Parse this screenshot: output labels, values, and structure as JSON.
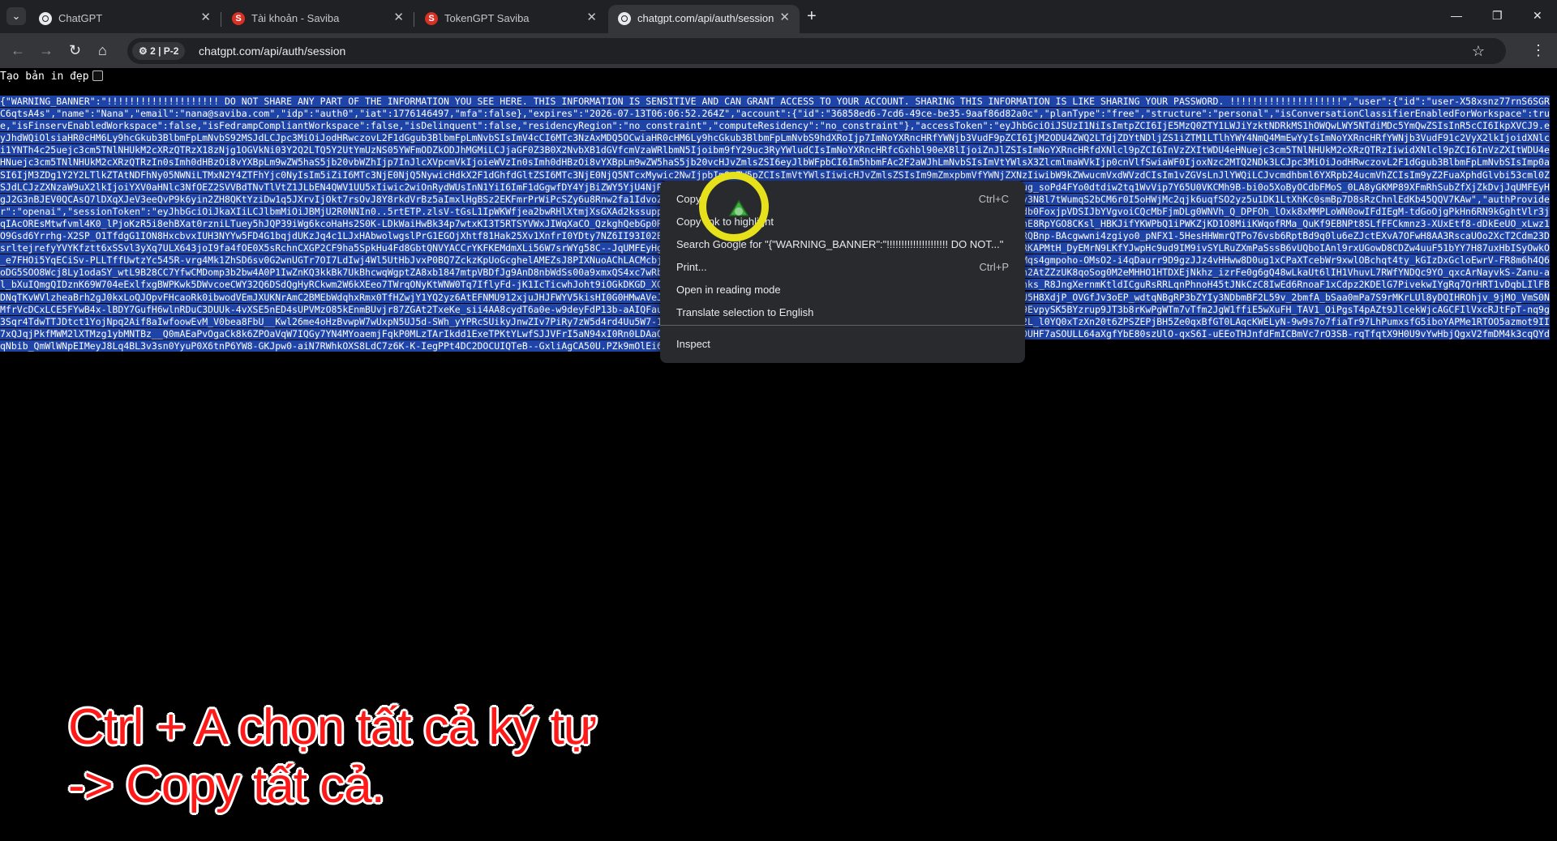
{
  "browser": {
    "tabs": [
      {
        "title": "ChatGPT",
        "favicon": "chatgpt-icon",
        "active": false
      },
      {
        "title": "Tài khoản - Saviba",
        "favicon": "saviba-icon",
        "active": false
      },
      {
        "title": "TokenGPT Saviba",
        "favicon": "saviba-icon",
        "active": false
      },
      {
        "title": "chatgpt.com/api/auth/session",
        "favicon": "chatgpt-icon",
        "active": true
      }
    ],
    "profile_chip": "2 | P-2",
    "url": "chatgpt.com/api/auth/session"
  },
  "page": {
    "pretty_print_label": "Tạo bản in đẹp",
    "json_text": "{\"WARNING_BANNER\":\"!!!!!!!!!!!!!!!!!!!! DO NOT SHARE ANY PART OF THE INFORMATION YOU SEE HERE. THIS INFORMATION IS SENSITIVE AND CAN GRANT ACCESS TO YOUR ACCOUNT. SHARING THIS INFORMATION IS LIKE SHARING YOUR PASSWORD. !!!!!!!!!!!!!!!!!!!!\",\"user\":{\"id\":\"user-X58xsnz77rnS6SGRC6qtsA4s\",\"name\":\"Nana\",\"email\":\"nana@saviba.com\",\"idp\":\"auth0\",\"iat\":1776146497,\"mfa\":false},\"expires\":\"2026-07-13T06:06:52.264Z\",\"account\":{\"id\":\"36858ed6-7cd6-49ce-be35-9aaf86d82a0c\",\"planType\":\"free\",\"structure\":\"personal\",\"isConversationClassifierEnabledForWorkspace\":true,\"isFinservEnabledWorkspace\":false,\"isFedrampCompliantWorkspace\":false,\"isDelinquent\":false,\"residencyRegion\":\"no_constraint\",\"computeResidency\":\"no_constraint\"},\"accessToken\":\"eyJhbGciOiJSUzI1NiIsImtpZCI6IjE5MzQ0ZTY1LWJiYzktNDRkMS1hOWQwLWY5NTdiMDc5YmQwZSIsInR5cCI6IkpXVCJ9.eyJhdWQiOlsiaHR0cHM6Ly9hcGkub3BlbmFpLmNvbS92MSJdLCJpc3MiOiJodHRwczovL2F1dGgub3BlbmFpLmNvbSIsImV4cCI6MTc3NzAxMDQ5OCwiaHR0cHM6Ly9hcGkub3BlbmFpLmNvbS9hdXRoIjp7ImNoYXRncHRfYWNjb3VudF9pZCI6IjM2ODU4ZWQ2LTdjZDYtNDljZS1iZTM1LTlhYWY4NmQ4MmEwYyIsImNoYXRncHRfYWNjb3VudF91c2VyX2lkIjoidXNlci1YNTh4c25uejc3cm5TNlNHUkM2cXRzQTRzX18zNjg1OGVkNi03Y2Q2LTQ5Y2UtYmUzNS05YWFmODZkODJhMGMiLCJjaGF0Z3B0X2NvbXB1dGVfcmVzaWRlbmN5Ijoibm9fY29uc3RyYWludCIsImNoYXRncHRfcGxhbl90eXBlIjoiZnJlZSIsImNoYXRncHRfdXNlcl9pZCI6InVzZXItWDU4eHNuejc3cm5TNlNHUkM2cXRzQTRzIiwidXNlcl9pZCI6InVzZXItWDU4eHNuejc3cm5TNlNHUkM2cXRzQTRzIn0sImh0dHBzOi8vYXBpLm9wZW5haS5jb20vbWZhIjp7InJlcXVpcmVkIjoieWVzIn0sImh0dHBzOi8vYXBpLm9wZW5haS5jb20vcHJvZmlsZSI6eyJlbWFpbCI6Im5hbmFAc2F2aWJhLmNvbSIsImVtYWlsX3ZlcmlmaWVkIjp0cnVlfSwiaWF0IjoxNzc2MTQ2NDk3LCJpc3MiOiJodHRwczovL2F1dGgub3BlbmFpLmNvbSIsImp0aSI6IjM3ZDg1Y2Y2LTlkZTAtNDFhNy05NWNiLTMxN2Y4ZTFhYjc0NyIsIm5iZiI6MTc3NjE0NjQ5NywicHdkX2F1dGhfdGltZSI6MTc3NjE0NjQ5NTcxMywic2NwIjpbIm9wZW5pZCIsImVtYWlsIiwicHJvZmlsZSIsIm9mZmxpbmVfYWNjZXNzIiwibW9kZWwucmVxdWVzdCIsIm1vZGVsLnJlYWQiLCJvcmdhbml6YXRpb24ucmVhZCIsIm9yZ2FuaXphdGlvbi53cml0ZSJdLCJzZXNzaW9uX2lkIjoiYXV0aHNlc3NfOEZ2SVVBdTNvTlVtZ1JLbEN4QWV1UU5xIiwic2wiOnRydWUsInN1YiI6ImF1dGgwfDY4YjBiZWY5YjU4NjRiNDJkMmJlMDc0NiJ9.MFZ2Qlc5nOb2h8Q5GbGx9c2IuyjIhd4LR3bsMrBuiXOe_Pug_soPd4FYo0dtdiw2tq1WvVip7Y65U0VKCMh9B-bi0o5XoByOCdbFMoS_0LA8yGKMP89XFmRhSubZfXjZkDvjJqUMFEyHgJ2G3nBJEV0QCAsQ7lDXqXJeV3eeQvP9k6yin2ZH8QKtYziDw1q5JXrvIjOkt7rsOvJ8Y8rkdVrBz5aImxlHgBSz2EKFmrPrWiPcSZy6u8Rnw2fa1IdvoZPn15QYs7VB8pE8yqZuD9l4pjVpsHnZdEUVaaQ3zT8w9OY4R0XyKsRYbbpazeGf-6y3N8l7tWumqS2bCM6r0I5oHWjMc2qjk6uqfSO2yz5u1DK1LtXhKc0smBp7D8sRzChnlEdKb45QQV7KAw\",\"authProvider\":\"openai\",\"sessionToken\":\"eyJhbGciOiJkaXIiLCJlbmMiOiJBMjU2R0NNIn0..5rtETP.zlsV-tGsL1IpWKWfjea2bwRHlXtmjXsGXAd2kssuppdyTy2oXzD4E7bt-d-6gKPfz0FhTURmrbRPfrEnpQRWrOHgBkL_HxyCMsVOYfsHuOdb0FoxjpVDSIJbYVgvoiCQcMbFjmDLg0WNVh_Q_DPFOh_lOxk8xMMPLoWN0owIFdIEgM-tdGoOjgPkHn6RN9kGghtVlr3jqIAcOREsMtwfvml4K0_lPjoKzR5i8ehBXat0rzniLTuey5hJQP39iWg6kcoHaHs2S0K-LDkWaiHwBk34p7wtxKI3T5RTSYVWxJIWqXaCO_QzkghQebGp0R9CodZ4ki0u6biZR8x_y-XLj0izoKGkyd_2ueUW74ZRVrISLsU7LPiFq_zPMCZhb7nE8RpYGO8CKsl_HBKJifYKWPbQ1iPWKZjKD1O8MiiKWqofRMa_QuKf9EBNPt8SLfFFCkmnz3-XUxEtf8-dDkEeUO_xLwz1O9Gsd6Yrrhg-X2SP_O1TfdgG1ION8HxcbvxIUH3NYYw5FD4G1bqjdUKzJq4c1LJxHAbwolwgslPrG1EGOjXhtf81Hak25Xv1XnfrI0YDty7NZ6II93I02Bo96HmrpC6DW1LluZn5tfFxUJia7QYMcETqhgrUbWLTgClL_sbRshI-TD-Im3GfcMRQBnp-BAcgwwni4zgiyo0_pNFX1-5HesHHWmrQTPo76vsb6RptBd9q0lu6eZJctEXvA7OFwH8AA3RscaUOo2XcT2Cdm23DsrltejrefyYVYKfztt6xSSvl3yXq7ULX643joI9fa4fOE0X5sRchnCXGP2CF9ha5SpkHu4Fd8GbtQNVYACCrYKFKEMdmXLi56W7srWYg58C--JqUMFEyHgJ2G3nBJEV0QCAsQ7lDXqXJeV3eeQvP9k6yin2ZH8QKtYziDw1q5JDMqoN0KOzHNDRKAPMtH_DyEMrN9LKfYJwpHc9ud9IM9ivSYLRuZXmPaSssB6vUQboIAnl9rxUGowD8CDZw4uuF51bYY7H87uxHbISyOwkO_e7FHOi5YqECiSv-PLLTffUwtzYc545R-vrg4Mk1ZhSD6sv0G2wnUGTr7OI7LdIwj4Wl5UtHbJvxP0BQ7ZckzKpUoGcghelAMEZsJ8PIXNuoAChLACMcbjkh5Mc6_di8a36NKRviId1G_woQfRtRaias1m6B8A6RPmgjfbirr8ReI8mztLCfJ9Mqs4gmpoho-OMsO2-i4qDaurr9D9gzJJz4vHHww8D0ug1xCPaXTcebWr9xwlOBchqt4ty_kGIzDxGcloEwrV-FR8m6h4Q6oDG5SOO8Wcj8Ly1odaSY_wtL9B28CC7YfwCMDomp3b2bw4A0P1IwZnKQ3kkBk7UkBhcwqWgptZA8xb1847mtpVBDfJg9AnD8nbWdSs00a9xmxQS4xc7wRbQwuycuSYrKbKLzXgE8bzz23Lb9JceM7DLQottNR9eg0OV-2eBRlGmHaGOVHz1pn4n2AtZZzUK8qoSog0M2eMHHO1HTDXEjNkhz_izrFe0g6gQ48wLkaUt6lIH1VhuvL7RWfYNDQc9YO_qxcArNayvkS-Zanu-al_bXuIQmgQIDznK69W704eExlfxgBWPKwk5DWvcoeCWY32Q6DSdQgHyRCkwm2W6kXEeo7TWrqONyKtWNW0Tq7IflyFd-jK1IcTicwhJoht9iOGkDKGD_XGBzdxQeJY_2hA4bSVc42SVldVEU9gcCSnqAUNFfPTaKRPEojbEfp_zH0I64FIVyXnhks_R8JngXernmKtldICguRsRRLqnPhnoH45tJNkCzC8IwEd6RnoaF1xCdpz2KDElG7PivekwIYgRq7QrHRT1vDqbLIlFBDNqTKvWVlzheaBrh2gJ0kxLoQJOpvFHcaoRk0ibwodVEmJXUKNrAmC2BMEbWdqhxRmx0TfHZwjY1YQ2yz6AtEFNMU912xjuJHJFWYV5kisHI0G0HMwAVeJ0vd3uLE_hMuK6cgDc840aE9skwlWCq0_PMF_djj7Ymmk804fmiIX4YfG9hMo7TtnU5H8XdjP_OVGfJv3oEP_wdtqNBgRP3bZYIy3NDbmBF2L59v_2bmfA_bSaa0mPa7S9rMKrLUl8yDQIHROhjv_9jMO_VmS0NMfrVcDCxLCE5FYwB4x-lBDY7GufH6wlnRDuC3DUUk-4vXSE5nED4sUPVMzO85kEnmBUvjr87ZGAt2TxeKe_sii4AA8cydT6a0e-w9deyFdP13b-aAIQFaulqlilYIuPLR4ER0IYzz4OjEQiZy7EtFhUHexNsaQqc3IF1VaUSFtz7gUYdUnRHN59EvpySK5BYzrup9JT3b8rKwPgWTm7vTfm2JgW1ffiE5wXuFH_TAV1_OiPgsT4pAZt9JlcekWjcAGCFIlVxcRJtFpT-nq9g3Sqr4TdwTTJDtct1YojNpq2Aif8aIwfoowEvM_V0bea8FbU__Kwl26me4oHzBvwpW7wUxpN5UJ5d-SWh_yYPRcSUikyJnwZIv7PiRy7zW5d4rd4Uu5W7-10yH7yOrUIL1b2LFgPMk7Nf5NdfwYrKr53s3-jmTAPRf3GwP9JVvZA2QcFEhFurC-2L_l0YQ0xTzXn20t6ZPSZEPjBH5Ze0qxBfGT0LAqcKWELyN-9w9s7o7fiaTr97LhPumxsfG5iboYAPMe1RTOO5azmot9II7xQJqjPkfMWM2lXTMzg1ybMNTBz__Q0mAEaPvOgaCk8k6ZPOaVqW7IQGy7YN4MYoaemjFqkP0MLzTArIkdd1ExeTPKtYLwfSJJVFrI5aN94xI0Rn0LDAaQ7EQOUj4aNgZxZcyl55eNvcxi3M1Fm31wzKoNjEExfJ9RIfbAFI7ljVssF2DGBGKwDUHF7aSOULL64aXgfYbE80szUlO-qxS6I-uEEoTHJnfdFmICBmVc7rO3SB-rqTfqtX9H0U9vYwHbjQgxV2fmDM4k3cqQYdqNbib_QmWlWNpEIMeyJ8Lq4BL3v3sn0YyuP0X6tnP6YW8-GKJpw0-aiN7RWhkOXS8LdC7z6K-K-IegPPt4DC2DOCUIQTeB--GxliAgCA50U.PZk9mOlEi60Y17r4VAp7NA\",\"rumViewTags\":{\"light_account\":{\"fetched\":false}}}"
  },
  "context_menu": {
    "items": [
      {
        "label": "Copy",
        "shortcut": "Ctrl+C"
      },
      {
        "label": "Copy link to highlight",
        "shortcut": ""
      },
      {
        "label": "Search Google for \"{\"WARNING_BANNER\":\"!!!!!!!!!!!!!!!!!!!!! DO NOT...\"",
        "shortcut": ""
      },
      {
        "label": "Print...",
        "shortcut": "Ctrl+P"
      },
      {
        "label": "Open in reading mode",
        "shortcut": ""
      },
      {
        "label": "Translate selection to English",
        "shortcut": ""
      },
      {
        "label": "Inspect",
        "shortcut": ""
      }
    ]
  },
  "caption": {
    "line1": "Ctrl + A chọn tất cả ký tự",
    "line2": "-> Copy tất cả."
  },
  "colors": {
    "selection": "#1f44a8",
    "caption_text": "#ff1a1a",
    "cursor_ring": "#e7e11b"
  }
}
